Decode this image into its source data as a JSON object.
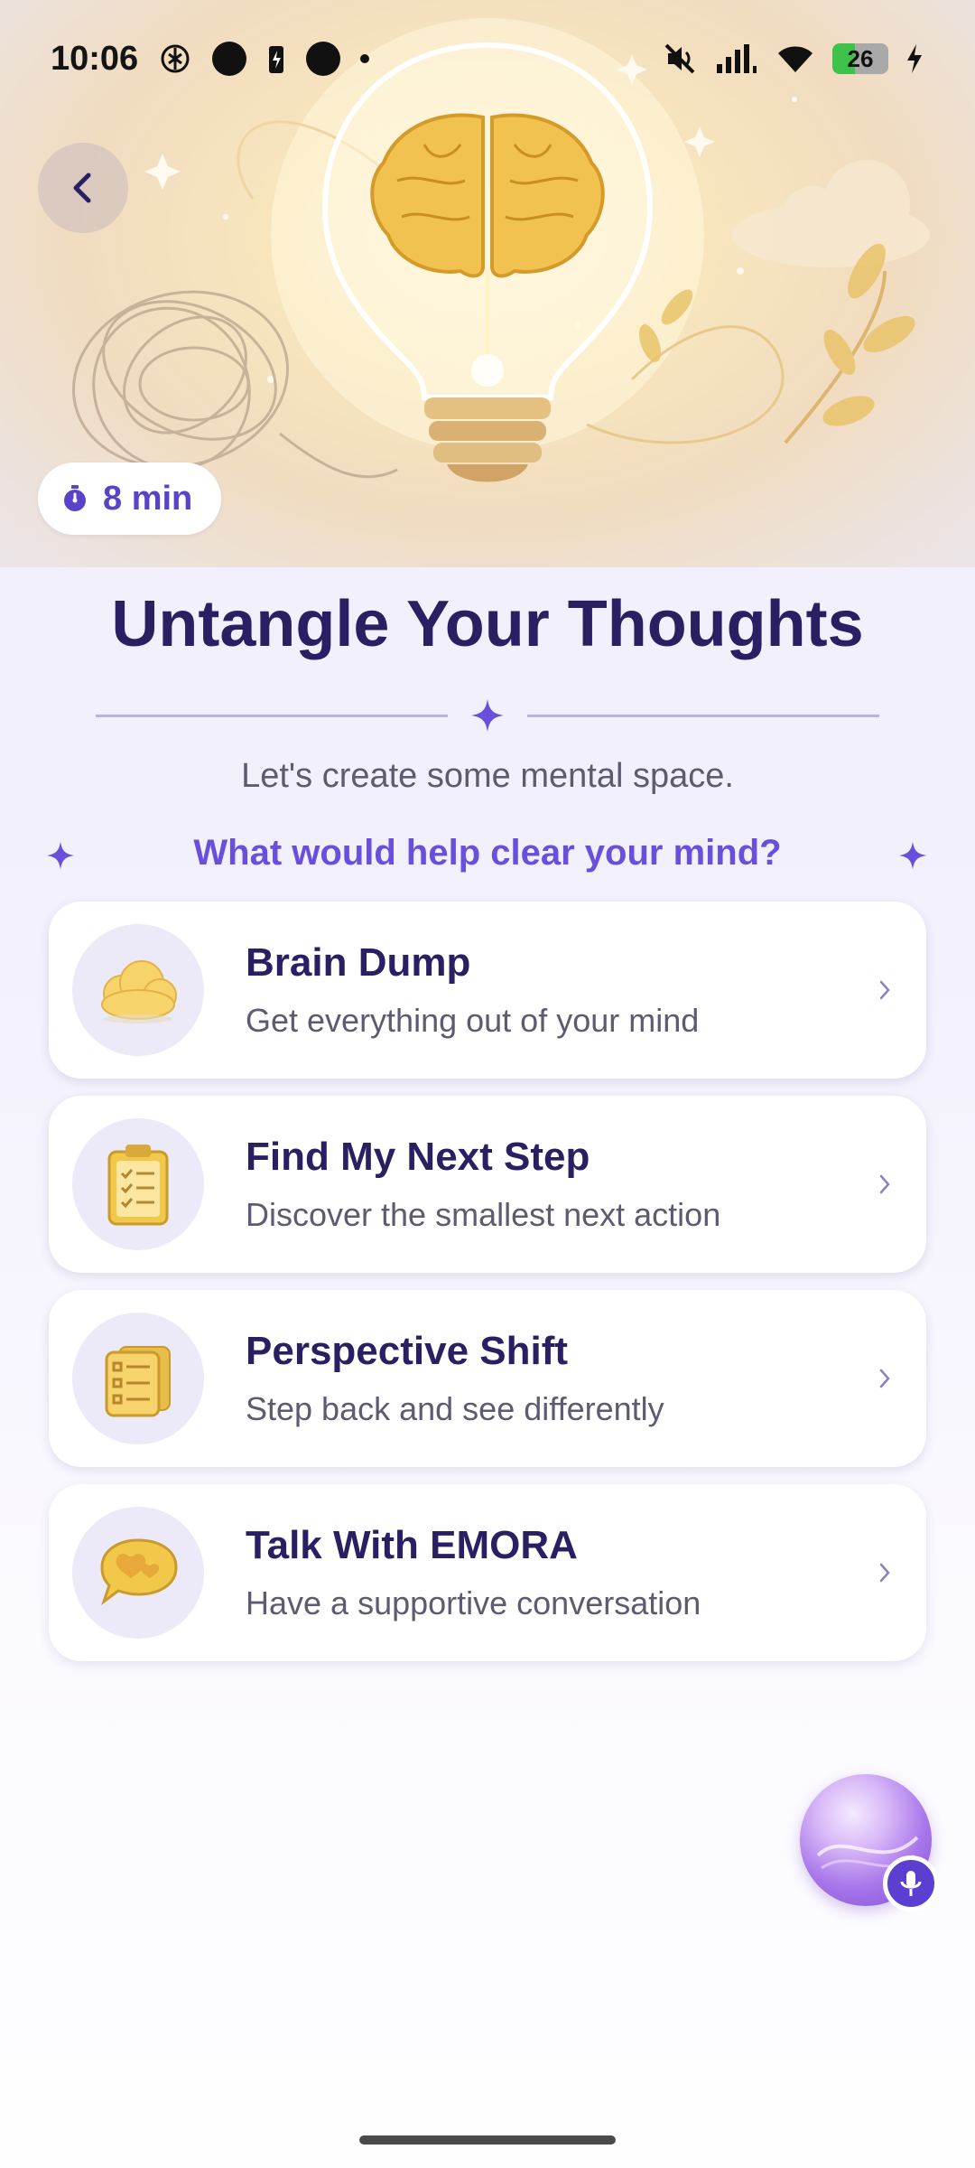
{
  "status_bar": {
    "time": "10:06",
    "battery": "26"
  },
  "hero": {
    "duration": "8 min"
  },
  "page_title": "Untangle Your Thoughts",
  "subtitle": "Let's create some mental space.",
  "prompt": "What would help clear your mind?",
  "options": [
    {
      "title": "Brain Dump",
      "description": "Get everything out of your mind",
      "icon": "cloud-icon"
    },
    {
      "title": "Find My Next Step",
      "description": "Discover the smallest next action",
      "icon": "clipboard-checklist-icon"
    },
    {
      "title": "Perspective Shift",
      "description": "Step back and see differently",
      "icon": "stacked-cards-icon"
    },
    {
      "title": "Talk With EMORA",
      "description": "Have a supportive conversation",
      "icon": "chat-heart-icon"
    }
  ],
  "colors": {
    "title": "#2a1f62",
    "accent": "#6a4fdc",
    "icon_gold": "#f2c84b"
  }
}
